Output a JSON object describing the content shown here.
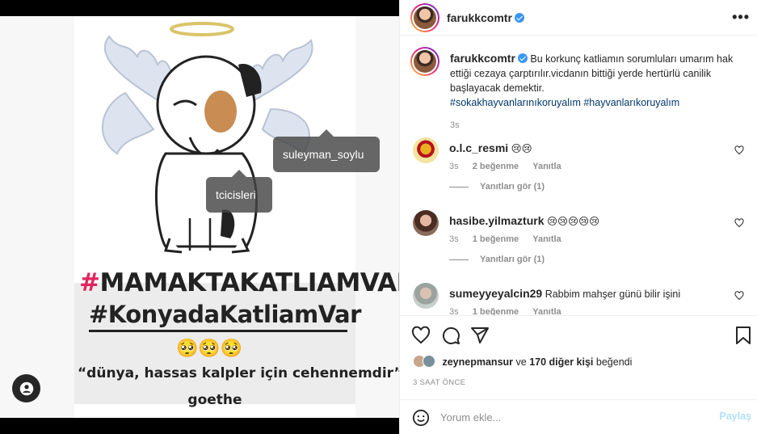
{
  "post": {
    "author": "farukkcomtr",
    "verified": true,
    "media": {
      "hashtag_line_1_mark": "#",
      "hashtag_line_1": "MAMAKTAKATLIAMVAR",
      "hashtag_line_2": "#KonyadaKatliamVar",
      "emoji_line": "🥺🥺🥺",
      "quote": "“dünya, hassas kalpler için cehennemdir”",
      "quote_author": "goethe",
      "user_tags": [
        "suleyman_soylu",
        "tcicisleri"
      ]
    },
    "caption": {
      "username": "farukkcomtr",
      "text": "Bu korkunç katliamın sorumluları umarım hak ettiği cezaya çarptırılır.vicdanın bittiği yerde hertürlü canilik başlayacak demektir.",
      "hashtags": "#sokakhayvanlarınıkoruyalım #hayvanlarıkoruyalım",
      "time": "3s"
    },
    "comments": [
      {
        "username": "o.l.c_resmi",
        "text": "😢😢",
        "time": "3s",
        "likes": "2 beğenme",
        "reply": "Yanıtla",
        "view_replies": "Yanıtları gör (1)"
      },
      {
        "username": "hasibe.yilmazturk",
        "text": "😢😢😢😢😢",
        "time": "3s",
        "likes": "1 beğenme",
        "reply": "Yanıtla",
        "view_replies": "Yanıtları gör (1)"
      },
      {
        "username": "sumeyyeyalcin29",
        "text": "Rabbim mahşer günü bilir işini",
        "time": "3s",
        "likes": "1 beğenme",
        "reply": "Yanıtla"
      }
    ],
    "likes": {
      "first_user": "zeynepmansur",
      "connector": "ve",
      "others": "170 diğer kişi",
      "suffix": "beğendi"
    },
    "time_ago": "3 SAAT ÖNCE",
    "add_comment": {
      "placeholder": "Yorum ekle...",
      "post_label": "Paylaş"
    }
  },
  "colors": {
    "link": "#00376b",
    "verified": "#3897f0",
    "muted": "#8e8e8e",
    "post_disabled": "#b2dffc"
  }
}
